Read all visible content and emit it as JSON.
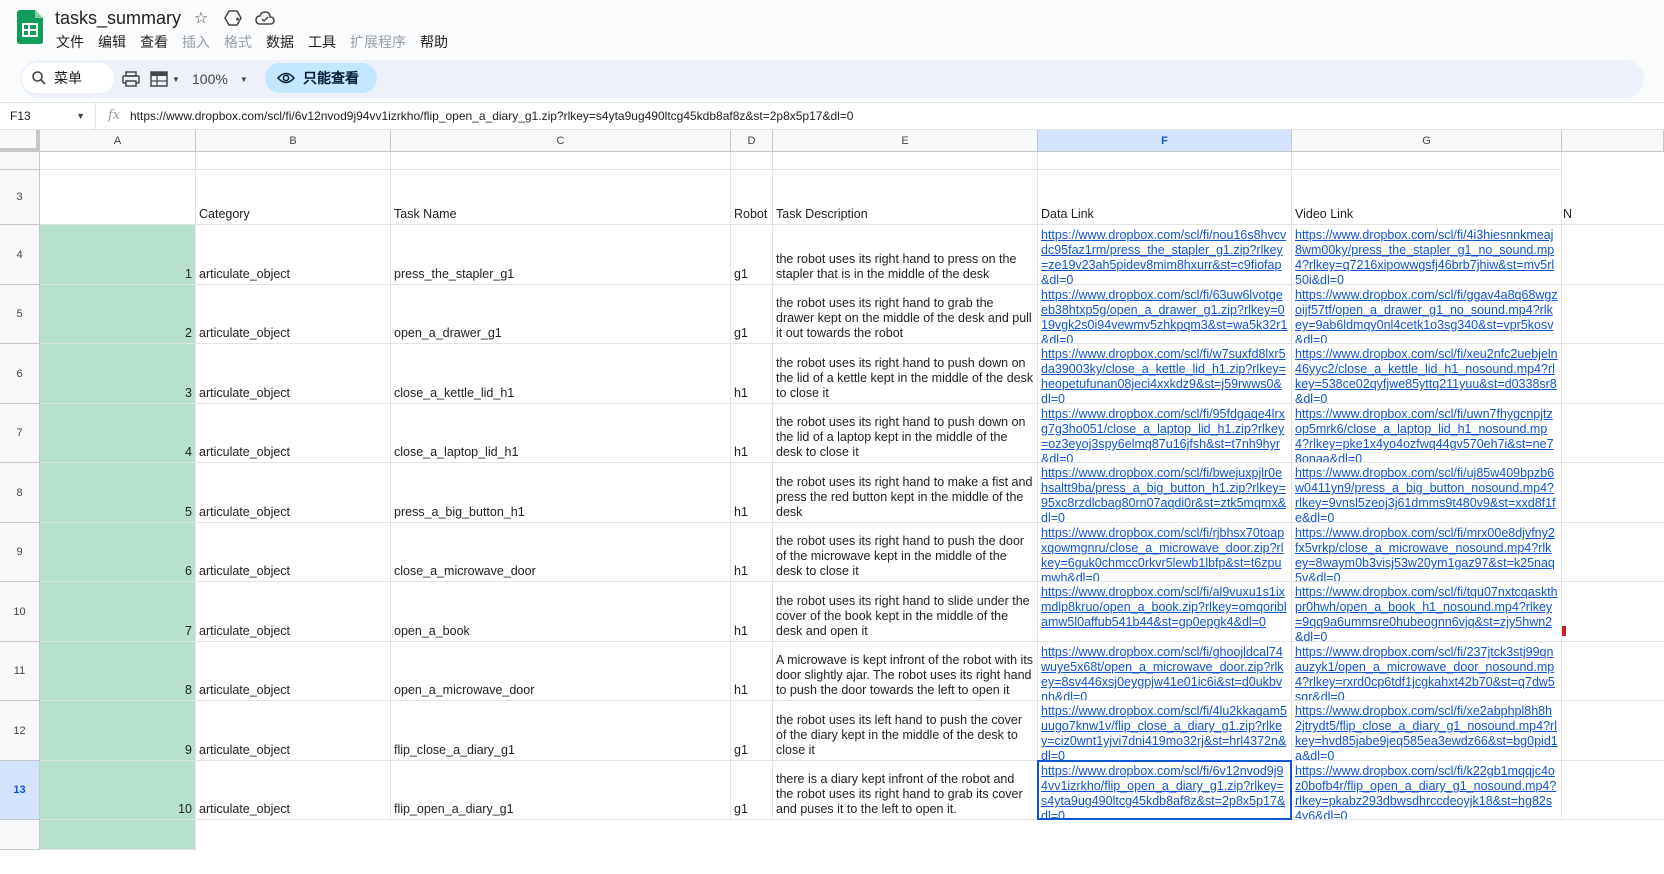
{
  "app": {
    "title": "tasks_summary",
    "menu": [
      {
        "label": "文件",
        "disabled": false
      },
      {
        "label": "编辑",
        "disabled": false
      },
      {
        "label": "查看",
        "disabled": false
      },
      {
        "label": "插入",
        "disabled": true
      },
      {
        "label": "格式",
        "disabled": true
      },
      {
        "label": "数据",
        "disabled": false
      },
      {
        "label": "工具",
        "disabled": false
      },
      {
        "label": "扩展程序",
        "disabled": true
      },
      {
        "label": "帮助",
        "disabled": false
      }
    ]
  },
  "toolbar": {
    "search_label": "菜单",
    "zoom": "100%",
    "readonly_label": "只能查看"
  },
  "formula_bar": {
    "cell_ref": "F13",
    "fx": "fx",
    "value": "https://www.dropbox.com/scl/fi/6v12nvod9j94vv1izrkho/flip_open_a_diary_g1.zip?rlkey=s4yta9ug490ltcg45kdb8af8z&st=2p8x5p17&dl=0"
  },
  "columns": [
    "A",
    "B",
    "C",
    "D",
    "E",
    "F",
    "G"
  ],
  "selected_column": "F",
  "selected_row": "13",
  "header_row": {
    "row_number": "3",
    "category": "Category",
    "task_name": "Task Name",
    "robot": "Robot",
    "task_description": "Task Description",
    "data_link": "Data Link",
    "video_link": "Video Link",
    "overflow": "N"
  },
  "rows": [
    {
      "row_number": "4",
      "index": "1",
      "category": "articulate_object",
      "task_name": "press_the_stapler_g1",
      "robot": "g1",
      "description": "the robot uses its right hand to press on the stapler that is in the middle of the desk",
      "data_link": "https://www.dropbox.com/scl/fi/nou16s8hvcvdc95faz1rm/press_the_stapler_g1.zip?rlkey=ze19v23ah5pidev8mim8hxurr&st=c9fiofap&dl=0",
      "video_link": "https://www.dropbox.com/scl/fi/4i3hiesnnkmeaj8wm00ky/press_the_stapler_g1_no_sound.mp4?rlkey=q7216xipowwgsfj46brb7jhiw&st=mv5rl50i&dl=0"
    },
    {
      "row_number": "5",
      "index": "2",
      "category": "articulate_object",
      "task_name": "open_a_drawer_g1",
      "robot": "g1",
      "description": "the robot uses its right hand to grab the drawer kept on the middle of the desk and pull it out towards the robot",
      "data_link": "https://www.dropbox.com/scl/fi/63uw6lvotgeeb38htxp5g/open_a_drawer_g1.zip?rlkey=019vgk2s0i94vewmv5zhkpqm3&st=wa5k32r1&dl=0",
      "video_link": "https://www.dropbox.com/scl/fi/ggav4a8q68wgzoijf57tf/open_a_drawer_g1_no_sound.mp4?rlkey=9ab6ldmqy0nl4cetk1o3sg340&st=vpr5kosv&dl=0"
    },
    {
      "row_number": "6",
      "index": "3",
      "category": "articulate_object",
      "task_name": "close_a_kettle_lid_h1",
      "robot": "h1",
      "description": "the robot uses its right hand to push down on the lid of a kettle kept in the middle of the desk to close it",
      "data_link": "https://www.dropbox.com/scl/fi/w7suxfd8lxr5da39003ky/close_a_kettle_lid_h1.zip?rlkey=heopetufunan08jeci4xxkdz9&st=j59rwws0&dl=0",
      "video_link": "https://www.dropbox.com/scl/fi/xeu2nfc2uebjeln46yyc2/close_a_kettle_lid_h1_nosound.mp4?rlkey=538ce02qyfjwe85yttq211yuu&st=d0338sr8&dl=0"
    },
    {
      "row_number": "7",
      "index": "4",
      "category": "articulate_object",
      "task_name": "close_a_laptop_lid_h1",
      "robot": "h1",
      "description": "the robot uses its right hand to push down on the lid of a laptop kept in the middle of the desk to close it",
      "data_link": "https://www.dropbox.com/scl/fi/95fdgaqe4lrxg7g3ho051/close_a_laptop_lid_h1.zip?rlkey=oz3eyoj3spy6elmq87u16jfsh&st=t7nh9hyr&dl=0",
      "video_link": "https://www.dropbox.com/scl/fi/uwn7fhygcnpjtzop5mrk6/close_a_laptop_lid_h1_nosound.mp4?rlkey=pke1x4yo4ozfwq44gv570eh7i&st=ne78onaa&dl=0"
    },
    {
      "row_number": "8",
      "index": "5",
      "category": "articulate_object",
      "task_name": "press_a_big_button_h1",
      "robot": "h1",
      "description": "the robot uses its right hand to make a fist and press the red button kept in the middle of the desk",
      "data_link": "https://www.dropbox.com/scl/fi/bwejuxpjlr0ehsaltt9ba/press_a_big_button_h1.zip?rlkey=95xc8rzdlcbag80rn07aqdi0r&st=ztk5mqmx&dl=0",
      "video_link": "https://www.dropbox.com/scl/fi/uj85w409bpzb6w0411yn9/press_a_big_button_nosound.mp4?rlkey=9vnsl5zeoj3j61dmms9t480v9&st=xxd8f1fe&dl=0"
    },
    {
      "row_number": "9",
      "index": "6",
      "category": "articulate_object",
      "task_name": "close_a_microwave_door",
      "robot": "h1",
      "description": "the robot uses its right hand to push the door of the microwave kept in the middle of the desk to close it",
      "data_link": "https://www.dropbox.com/scl/fi/rjbhsx70toapxqowmgnru/close_a_microwave_door.zip?rlkey=6guk0chmcc0rkvr5lewb1lbfp&st=t6zpumwh&dl=0",
      "video_link": "https://www.dropbox.com/scl/fi/mrx00e8djvfny2fx5vrkp/close_a_microwave_nosound.mp4?rlkey=8waym0b3visj53w20ym1gaz97&st=k25naq5v&dl=0"
    },
    {
      "row_number": "10",
      "index": "7",
      "category": "articulate_object",
      "task_name": "open_a_book",
      "robot": "h1",
      "description": "the robot uses its right hand to slide under the cover of the book kept in the middle of the desk and open it",
      "data_link": "https://www.dropbox.com/scl/fi/al9vuxu1s1ixmdlp8kruo/open_a_book.zip?rlkey=omqoriblamw5l0affub541b44&st=gp0epgk4&dl=0",
      "video_link": "https://www.dropbox.com/scl/fi/tqu07nxtcqaskthpr0hwh/open_a_book_h1_nosound.mp4?rlkey=9qq9a6ummsre0hubeognn6vjq&st=zjy5hwn2&dl=0"
    },
    {
      "row_number": "11",
      "index": "8",
      "category": "articulate_object",
      "task_name": "open_a_microwave_door",
      "robot": "h1",
      "description": "A microwave is kept infront of the robot with its door slightly ajar. The robot uses its right hand to push the door towards the left to open it",
      "data_link": "https://www.dropbox.com/scl/fi/ghoojldcal74wuye5x68t/open_a_microwave_door.zip?rlkey=8sv446xsj0eygpjw41e01ic6i&st=d0ukbvnh&dl=0",
      "video_link": "https://www.dropbox.com/scl/fi/237jtck3stj99qnauzyk1/open_a_microwave_door_nosound.mp4?rlkey=rxrd0cp6tdf1jcgkahxt42b70&st=q7dw5sgr&dl=0"
    },
    {
      "row_number": "12",
      "index": "9",
      "category": "articulate_object",
      "task_name": "flip_close_a_diary_g1",
      "robot": "g1",
      "description": "the robot uses its left hand to push the cover of the diary kept in the middle of the desk to close it",
      "data_link": "https://www.dropbox.com/scl/fi/4lu2kkagam5uugo7knw1v/flip_close_a_diary_g1.zip?rlkey=ciz0wnt1yjvi7dni419mo32rj&st=hrl4372n&dl=0",
      "video_link": "https://www.dropbox.com/scl/fi/xe2abphpl8h8h2jtrydt5/flip_close_a_diary_g1_nosound.mp4?rlkey=hvd85jabe9jeq585ea3ewdz66&st=bg0pid1a&dl=0"
    },
    {
      "row_number": "13",
      "index": "10",
      "category": "articulate_object",
      "task_name": "flip_open_a_diary_g1",
      "robot": "g1",
      "description": "there is a diary kept infront of the robot and the robot uses its right hand to grab its cover and puses it to the left to open it.",
      "data_link": "https://www.dropbox.com/scl/fi/6v12nvod9j94vv1izrkho/flip_open_a_diary_g1.zip?rlkey=s4yta9ug490ltcg45kdb8af8z&st=2p8x5p17&dl=0",
      "video_link": "https://www.dropbox.com/scl/fi/k22gb1mqqjc4oz0bofb4r/flip_open_a_diary_g1_nosound.mp4?rlkey=pkabz293dbwsdhrccdeoyjk18&st=hg82s4y6&dl=0"
    }
  ],
  "colors": {
    "index_fill": "#b7e1cd",
    "link": "#1155cc",
    "selection": "#0b57d0",
    "readonly_pill": "#c2e7ff"
  }
}
